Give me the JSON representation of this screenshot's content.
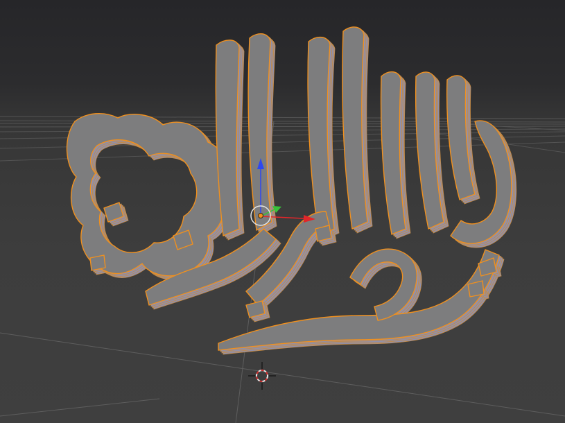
{
  "viewport": {
    "mode": "3d-viewport",
    "background_color": "#3d3d3d",
    "grid_color": "#575757",
    "selection_outline_color": "#f0901e"
  },
  "object": {
    "type": "extruded-3d-text",
    "face_color": "#7d7d7e",
    "side_color": "#9798b4"
  },
  "manipulator": {
    "axes": [
      "x",
      "y",
      "z"
    ],
    "x_color": "#e0262a",
    "y_color": "#38c23a",
    "z_color": "#2e48f0"
  },
  "cursor": {
    "ring_colors": [
      "#e8e8e8",
      "#d83030"
    ]
  }
}
